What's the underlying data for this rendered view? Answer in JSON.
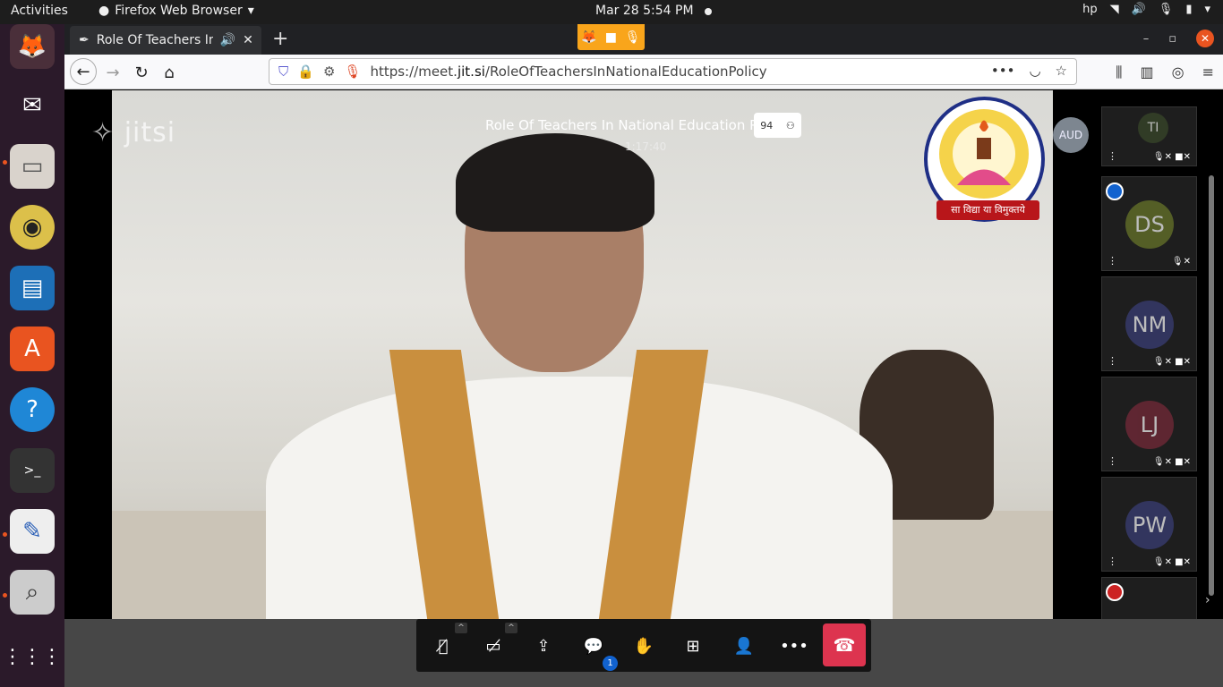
{
  "topbar": {
    "activities": "Activities",
    "app_name": "Firefox Web Browser",
    "clock": "Mar 28  5:54 PM"
  },
  "dock": {
    "items": [
      "firefox-icon",
      "thunderbird-icon",
      "files-icon",
      "rhythmbox-icon",
      "writer-icon",
      "software-icon",
      "help-icon",
      "terminal-icon",
      "text-editor-icon",
      "screenshot-icon",
      "apps-grid-icon"
    ]
  },
  "browser": {
    "tab_title": "Role Of Teachers In Na",
    "url_prefix": "https://meet.",
    "url_domain": "jit.si",
    "url_path": "/RoleOfTeachersInNationalEducationPolicy"
  },
  "meeting": {
    "title": "Role Of Teachers In National Education Policy",
    "participant_count": "94",
    "elapsed": "1:17:40",
    "watermark": "jitsi",
    "audio_only_badge": "AUD",
    "logo_motto": "सा विद्या या विमुक्तये",
    "chat_unread": "1"
  },
  "filmstrip": [
    {
      "initials": "TI",
      "color": "#3a4a2a"
    },
    {
      "initials": "DS",
      "color": "#6b7a2a"
    },
    {
      "initials": "NM",
      "color": "#3b3f7a"
    },
    {
      "initials": "LJ",
      "color": "#7a2a3a"
    },
    {
      "initials": "PW",
      "color": "#3b3f7a"
    }
  ]
}
